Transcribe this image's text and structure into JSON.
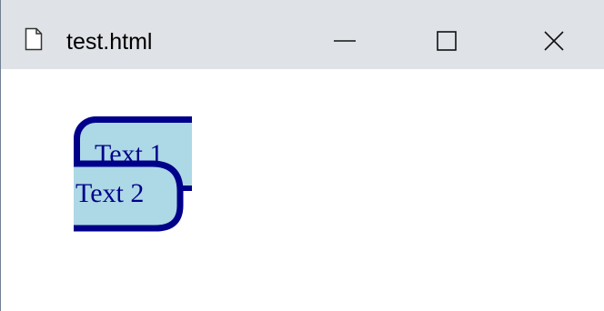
{
  "window": {
    "title": "test.html",
    "controls": {
      "minimize": "minimize-icon",
      "maximize": "maximize-icon",
      "close": "close-icon"
    }
  },
  "content": {
    "box1": {
      "text": "Text 1"
    },
    "box2": {
      "text": "Text 2"
    }
  },
  "colors": {
    "titlebar": "#dfe2e6",
    "box_fill": "#add8e6",
    "box_border": "#00008b",
    "text": "#00008b"
  }
}
